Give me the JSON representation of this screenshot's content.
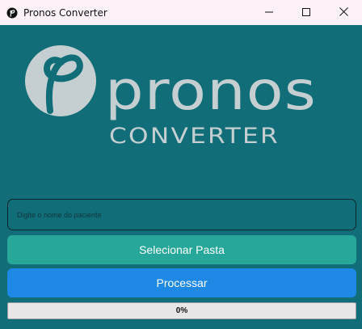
{
  "window": {
    "title": "Pronos Converter",
    "app_icon": "pronos-logo-icon",
    "controls": {
      "minimize": "minimize-icon",
      "maximize": "maximize-icon",
      "close": "close-icon"
    }
  },
  "logo": {
    "brand": "pronos",
    "subtitle": "CONVERTER"
  },
  "form": {
    "patient_placeholder": "Digite o nome do paciente",
    "patient_value": "",
    "select_folder_label": "Selecionar Pasta",
    "process_label": "Processar"
  },
  "progress": {
    "value": 0,
    "label": "0%"
  },
  "colors": {
    "background": "#116e78",
    "titlebar": "#fbf1f7",
    "logo": "#c5cfd1",
    "select_button": "#27a69a",
    "process_button": "#1e88e5",
    "progress_track": "#e9e6e7"
  }
}
